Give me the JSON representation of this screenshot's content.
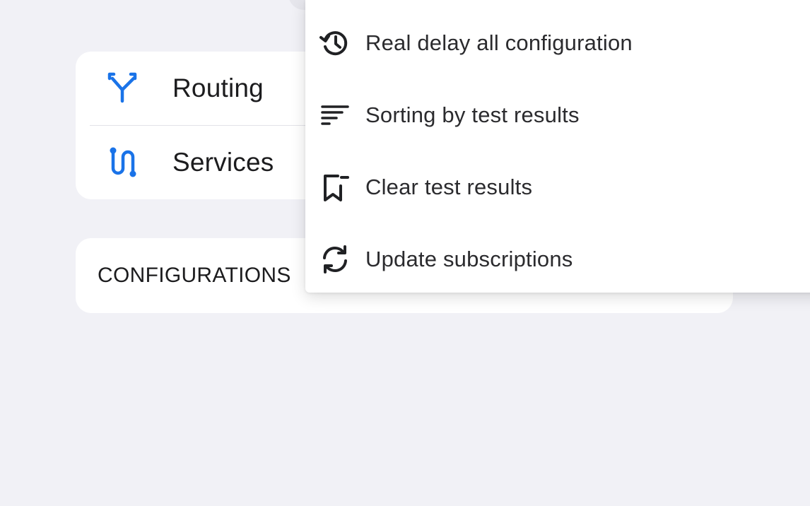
{
  "settings_list": {
    "items": [
      {
        "label": "Routing",
        "icon": "routing-icon"
      },
      {
        "label": "Services",
        "icon": "services-icon"
      }
    ],
    "accent_color": "#1a73e8"
  },
  "configurations": {
    "title": "CONFIGURATIONS"
  },
  "overflow_menu": {
    "items": [
      {
        "label": "Real delay all configuration",
        "icon": "history-icon"
      },
      {
        "label": "Sorting by test results",
        "icon": "sort-icon"
      },
      {
        "label": "Clear test results",
        "icon": "clear-bookmark-icon"
      },
      {
        "label": "Update subscriptions",
        "icon": "refresh-icon"
      }
    ]
  }
}
